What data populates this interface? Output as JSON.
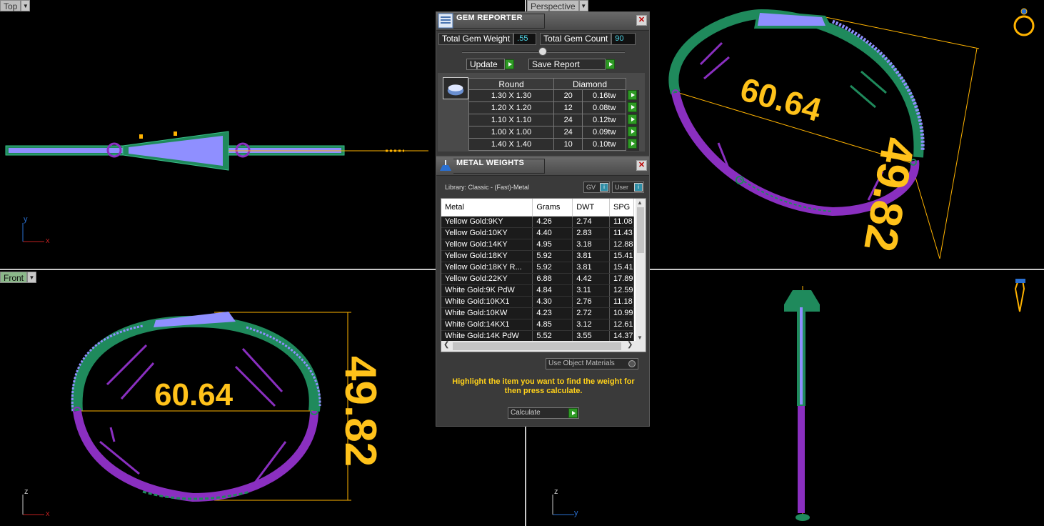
{
  "viewports": {
    "top": {
      "label": "Top"
    },
    "perspective": {
      "label": "Perspective"
    },
    "front": {
      "label": "Front"
    },
    "right": {
      "label": ""
    }
  },
  "axes": {
    "top": {
      "h": "x",
      "v": "y"
    },
    "front": {
      "h": "x",
      "v": "z"
    },
    "right": {
      "h": "y",
      "v": "z"
    }
  },
  "dimensions": {
    "width": "60.64",
    "height": "49.82"
  },
  "gem_reporter": {
    "title": "GEM REPORTER",
    "total_weight_label": "Total Gem Weight",
    "total_weight_value": ".55",
    "total_count_label": "Total Gem Count",
    "total_count_value": "90",
    "update_label": "Update",
    "save_report_label": "Save Report",
    "table": {
      "header_shape": "Round",
      "header_type": "Diamond",
      "rows": [
        {
          "size": "1.30 X 1.30",
          "count": "20",
          "weight": "0.16tw"
        },
        {
          "size": "1.20 X 1.20",
          "count": "12",
          "weight": "0.08tw"
        },
        {
          "size": "1.10 X 1.10",
          "count": "24",
          "weight": "0.12tw"
        },
        {
          "size": "1.00 X 1.00",
          "count": "24",
          "weight": "0.09tw"
        },
        {
          "size": "1.40 X 1.40",
          "count": "10",
          "weight": "0.10tw"
        }
      ]
    }
  },
  "metal_weights": {
    "title": "METAL WEIGHTS",
    "library": "Library: Classic - (Fast)-Metal",
    "gv_label": "GV",
    "user_label": "User",
    "columns": [
      "Metal",
      "Grams",
      "DWT",
      "SPG"
    ],
    "rows": [
      {
        "metal": "Yellow Gold:9KY",
        "grams": "4.26",
        "dwt": "2.74",
        "spg": "11.08"
      },
      {
        "metal": "Yellow Gold:10KY",
        "grams": "4.40",
        "dwt": "2.83",
        "spg": "11.43"
      },
      {
        "metal": "Yellow Gold:14KY",
        "grams": "4.95",
        "dwt": "3.18",
        "spg": "12.88"
      },
      {
        "metal": "Yellow Gold:18KY",
        "grams": "5.92",
        "dwt": "3.81",
        "spg": "15.41"
      },
      {
        "metal": "Yellow Gold:18KY R...",
        "grams": "5.92",
        "dwt": "3.81",
        "spg": "15.41"
      },
      {
        "metal": "Yellow Gold:22KY",
        "grams": "6.88",
        "dwt": "4.42",
        "spg": "17.89"
      },
      {
        "metal": "White Gold:9K PdW",
        "grams": "4.84",
        "dwt": "3.11",
        "spg": "12.59"
      },
      {
        "metal": "White Gold:10KX1",
        "grams": "4.30",
        "dwt": "2.76",
        "spg": "11.18"
      },
      {
        "metal": "White Gold:10KW",
        "grams": "4.23",
        "dwt": "2.72",
        "spg": "10.99"
      },
      {
        "metal": "White Gold:14KX1",
        "grams": "4.85",
        "dwt": "3.12",
        "spg": "12.61"
      },
      {
        "metal": "White Gold:14K PdW",
        "grams": "5.52",
        "dwt": "3.55",
        "spg": "14.37"
      }
    ],
    "use_object_materials": "Use Object Materials",
    "instruction": "Highlight the item you want to find the weight for then press calculate.",
    "calculate_label": "Calculate"
  },
  "colors": {
    "metal_green": "#1f8a5c",
    "metal_purple": "#8a2fc0",
    "gems": "#8f8fff",
    "dimension": "#ffb300",
    "dimension_text": "#ffc21a"
  }
}
